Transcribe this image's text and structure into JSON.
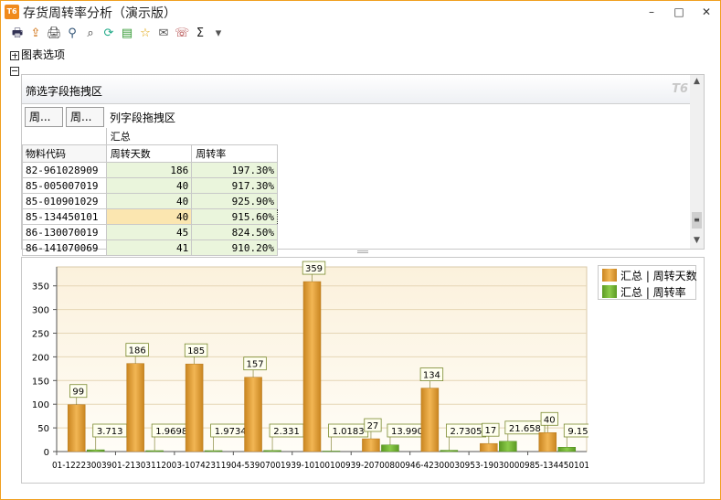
{
  "window": {
    "title": "存货周转率分析（演示版）",
    "app_icon_text": "T6",
    "minimize": "–",
    "maximize": "□",
    "close": "✕"
  },
  "toolbar": {
    "icons": [
      "print-preview-icon",
      "export-icon",
      "print-icon",
      "filter-icon",
      "find-icon",
      "refresh-icon",
      "excel-icon",
      "favorite-icon",
      "mail-icon",
      "comment-icon",
      "sum-icon",
      "dropdown-arrow-icon"
    ],
    "glyphs": [
      "🖶",
      "⇪",
      "🖨",
      "⚲",
      "⌕",
      "⟳",
      "▤",
      "☆",
      "✉",
      "☏",
      "Σ",
      "▾"
    ]
  },
  "chart_options": {
    "label": "图表选项"
  },
  "pivot": {
    "filter_zone_label": "筛选字段拖拽区",
    "watermark": "T6",
    "row_field_chips": [
      "周...",
      "周..."
    ],
    "column_zone_label": "列字段拖拽区",
    "group_header": "汇总",
    "row_header": "物料代码",
    "columns": [
      "周转天数",
      "周转率"
    ],
    "rows": [
      {
        "code": "82-961028909",
        "days": "186",
        "rate": "197.30%"
      },
      {
        "code": "85-005007019",
        "days": "40",
        "rate": "917.30%"
      },
      {
        "code": "85-010901029",
        "days": "40",
        "rate": "925.90%"
      },
      {
        "code": "85-134450101",
        "days": "40",
        "rate": "915.60%"
      },
      {
        "code": "86-130070019",
        "days": "45",
        "rate": "824.50%"
      },
      {
        "code": "86-141070069",
        "days": "41",
        "rate": "910.20%"
      }
    ],
    "selected_row": 3
  },
  "chart_data": {
    "type": "bar",
    "categories": [
      "01-12223003901",
      "01-21303112003",
      "-10742311904",
      "-53907001939",
      "-10100100939",
      "-20700800946",
      "-42300030953",
      "-19030000985",
      "-134450101"
    ],
    "x_axis_text": "01-12223003901-21303112003-10742311904-53907001939-10100100939-20700800946-42300030953-19030000985-134450101",
    "series": [
      {
        "name": "汇总 | 周转天数",
        "values": [
          99,
          186,
          185,
          157,
          359,
          27,
          134,
          17,
          40
        ],
        "labels": [
          "99",
          "186",
          "185",
          "157",
          "359",
          "27",
          "134",
          "17",
          "40"
        ],
        "color": "#e8a33a"
      },
      {
        "name": "汇总 | 周转率",
        "values": [
          3.713,
          1.9698,
          1.9734,
          2.331,
          1.0183,
          13.9901,
          2.7305,
          21.658,
          9.1563
        ],
        "labels": [
          "3.713",
          "1.9698",
          "1.9734",
          "2.331",
          "1.0183",
          "13.9901",
          "2.7305",
          "21.658",
          "9.1563"
        ],
        "color": "#7bb83a"
      }
    ],
    "ylim": [
      0,
      390
    ],
    "yticks": [
      0,
      50,
      100,
      150,
      200,
      250,
      300,
      350
    ],
    "grid": true,
    "legend_position": "top-right"
  }
}
